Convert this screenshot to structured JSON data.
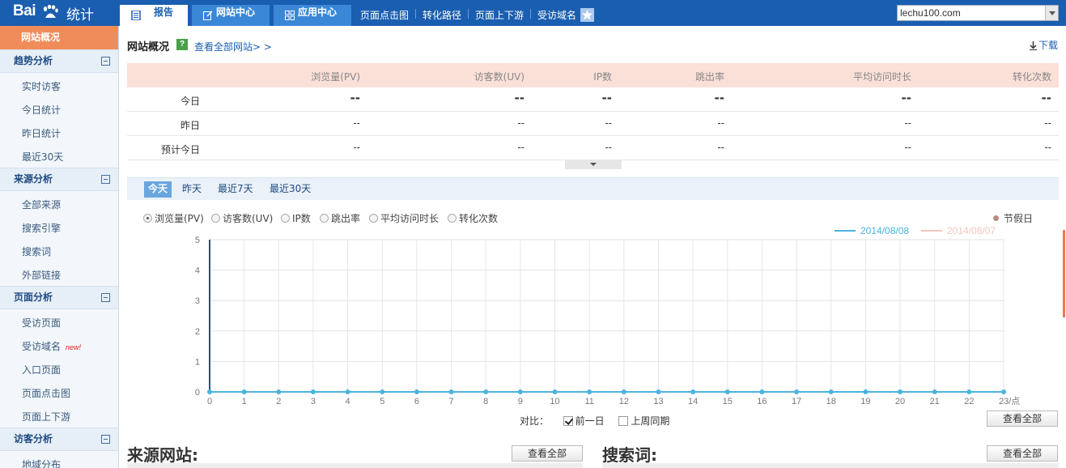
{
  "header": {
    "logo_bai": "Bai",
    "logo_du": "du",
    "logo_tongji": "统计",
    "tabs": [
      {
        "label": "报告"
      },
      {
        "label": "网站中心"
      },
      {
        "label": "应用中心"
      }
    ],
    "links": [
      "页面点击图",
      "转化路径",
      "页面上下游",
      "受访域名"
    ],
    "site_select": "lechu100.com"
  },
  "sidebar": {
    "active": "网站概况",
    "groups": [
      {
        "title": "趋势分析",
        "items": [
          "实时访客",
          "今日统计",
          "昨日统计",
          "最近30天"
        ]
      },
      {
        "title": "来源分析",
        "items": [
          "全部来源",
          "搜索引擎",
          "搜索词",
          "外部链接"
        ]
      },
      {
        "title": "页面分析",
        "items": [
          "受访页面",
          "受访域名",
          "入口页面",
          "页面点击图",
          "页面上下游"
        ]
      },
      {
        "title": "访客分析",
        "items": [
          "地域分布"
        ]
      }
    ],
    "new_badge": "new!"
  },
  "main": {
    "title": "网站概况",
    "help": "?",
    "view_all_sites": "查看全部网站> >",
    "download": "下载"
  },
  "summary": {
    "columns": [
      "浏览量(PV)",
      "访客数(UV)",
      "IP数",
      "跳出率",
      "平均访问时长",
      "转化次数"
    ],
    "rows": [
      {
        "label": "今日",
        "values": [
          "--",
          "--",
          "--",
          "--",
          "--",
          "--"
        ]
      },
      {
        "label": "昨日",
        "values": [
          "--",
          "--",
          "--",
          "--",
          "--",
          "--"
        ]
      },
      {
        "label": "预计今日",
        "values": [
          "--",
          "--",
          "--",
          "--",
          "--",
          "--"
        ]
      }
    ]
  },
  "ranges": [
    "今天",
    "昨天",
    "最近7天",
    "最近30天"
  ],
  "metrics": [
    "浏览量(PV)",
    "访客数(UV)",
    "IP数",
    "跳出率",
    "平均访问时长",
    "转化次数"
  ],
  "holiday": "节假日",
  "compare": {
    "label": "对比：",
    "options": [
      {
        "label": "前一日",
        "checked": true
      },
      {
        "label": "上周同期",
        "checked": false
      }
    ],
    "view_all": "查看全部"
  },
  "sections": [
    {
      "title": "来源网站:",
      "view_all": "查看全部"
    },
    {
      "title": "搜索词:",
      "view_all": "查看全部"
    }
  ],
  "colors": {
    "series_today": "#4bb3e0",
    "series_prev": "#f2c6bc"
  },
  "chart_data": {
    "type": "line",
    "x": [
      0,
      1,
      2,
      3,
      4,
      5,
      6,
      7,
      8,
      9,
      10,
      11,
      12,
      13,
      14,
      15,
      16,
      17,
      18,
      19,
      20,
      21,
      22,
      23
    ],
    "x_tick_labels": [
      "0",
      "1",
      "2",
      "3",
      "4",
      "5",
      "6",
      "7",
      "8",
      "9",
      "10",
      "11",
      "12",
      "13",
      "14",
      "15",
      "16",
      "17",
      "18",
      "19",
      "20",
      "21",
      "22",
      "23/点"
    ],
    "ylim": [
      0,
      5
    ],
    "y_ticks": [
      0,
      1,
      2,
      3,
      4,
      5
    ],
    "series": [
      {
        "name": "2014/08/08",
        "values": [
          0,
          0,
          0,
          0,
          0,
          0,
          0,
          0,
          0,
          0,
          0,
          0,
          0,
          0,
          0,
          0,
          0,
          0,
          0,
          0,
          0,
          0,
          0,
          0
        ]
      },
      {
        "name": "2014/08/07",
        "values": [
          0,
          0,
          0,
          0,
          0,
          0,
          0,
          0,
          0,
          0,
          0,
          0,
          0,
          0,
          0,
          0,
          0,
          0,
          0,
          0,
          0,
          0,
          0,
          0
        ]
      }
    ],
    "legend": "top-right",
    "grid": true
  }
}
